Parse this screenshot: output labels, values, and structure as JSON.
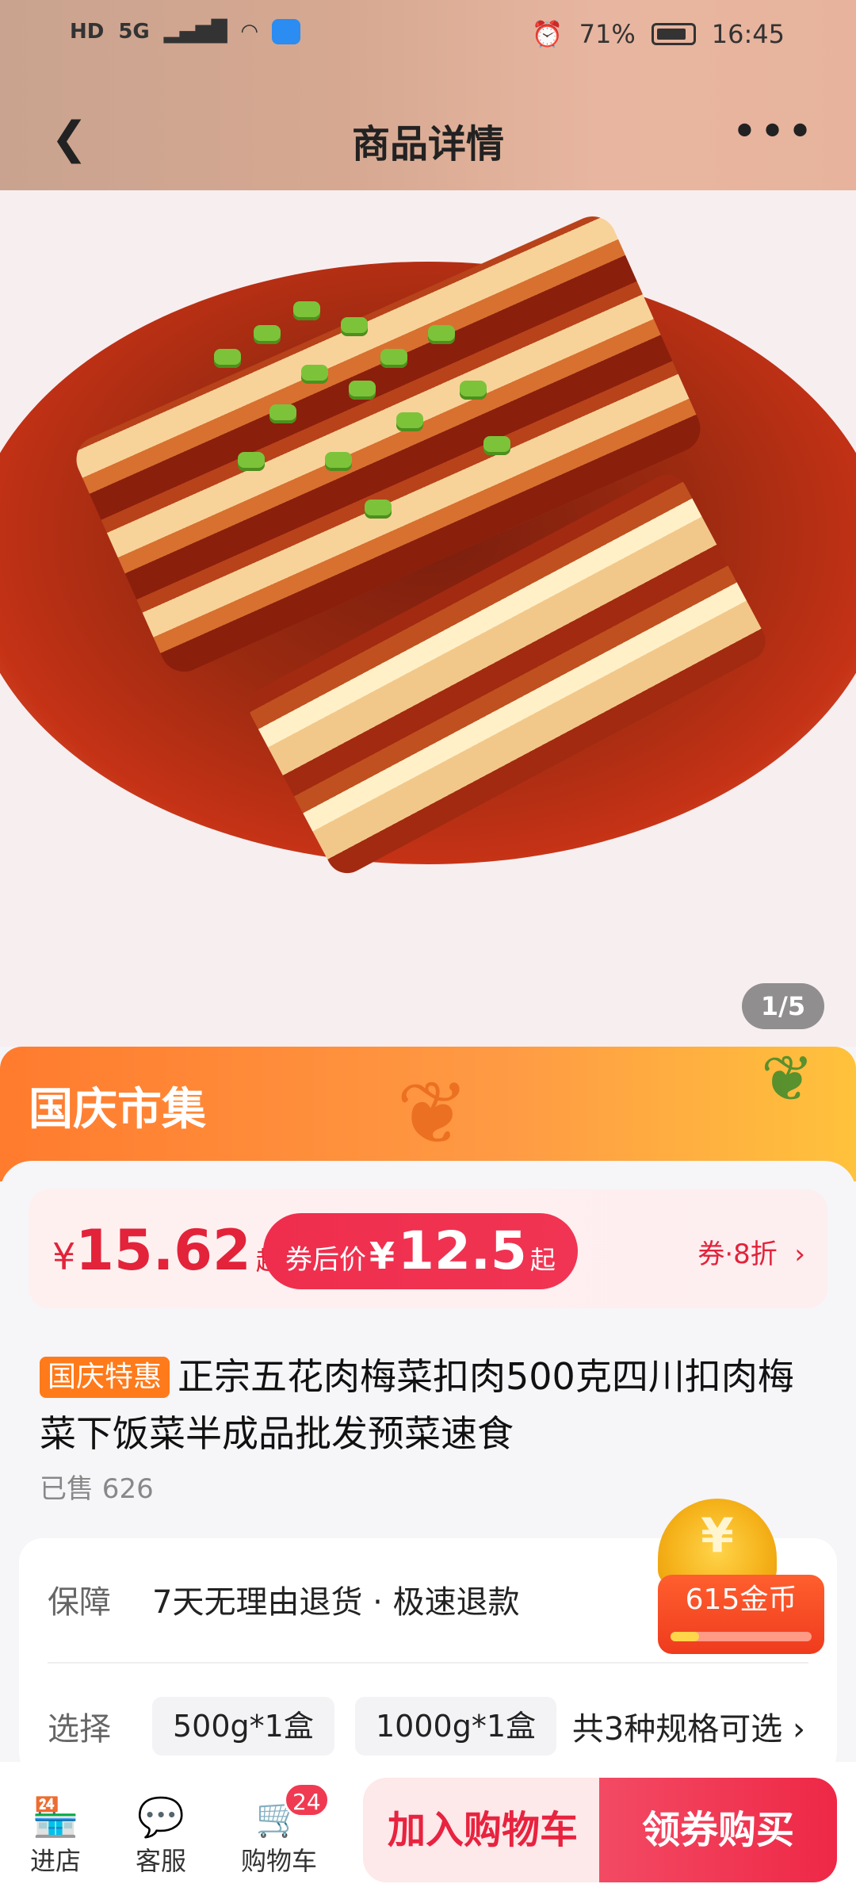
{
  "status_bar": {
    "left_icons": [
      "HD",
      "5G",
      "signal-icon",
      "wifi-icon",
      "weather-icon"
    ],
    "battery": "71%",
    "time": "16:45"
  },
  "nav": {
    "title": "商品详情"
  },
  "gallery": {
    "counter": "1/5"
  },
  "promo": {
    "title": "国庆市集"
  },
  "price": {
    "currency": "¥",
    "original": "15.62",
    "suffix": "起",
    "after_label": "券后价",
    "after": "12.5",
    "coupon": "券·8折"
  },
  "product": {
    "tag": "国庆特惠",
    "title": "正宗五花肉梅菜扣肉500克四川扣肉梅菜下饭菜半成品批发预菜速食",
    "sold": "已售 626"
  },
  "info": {
    "guarantee_label": "保障",
    "guarantee_text": "7天无理由退货 · 极速退款",
    "select_label": "选择",
    "options": [
      "500g*1盒",
      "1000g*1盒"
    ],
    "more_specs": "共3种规格可选"
  },
  "coins": {
    "label": "615金币",
    "progress": 0.2
  },
  "bottom": {
    "store": "进店",
    "service": "客服",
    "cart": "购物车",
    "cart_count": "24",
    "add_cart": "加入购物车",
    "buy": "领券购买"
  },
  "colors": {
    "accent": "#e8233f",
    "promo": "#ff8c3a"
  }
}
